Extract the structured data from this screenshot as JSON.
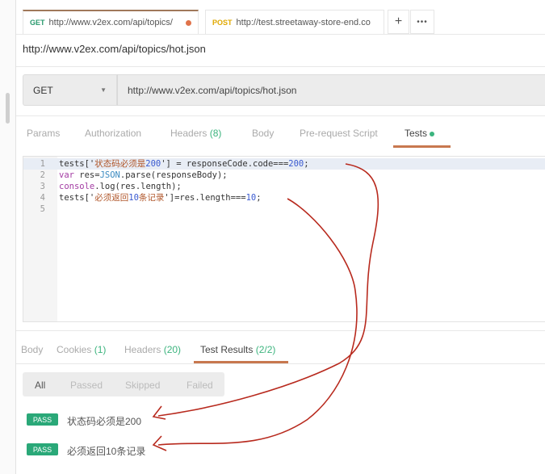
{
  "tabs": [
    {
      "method": "GET",
      "url": "http://www.v2ex.com/api/topics/",
      "unsaved": true
    },
    {
      "method": "POST",
      "url": "http://test.streetaway-store-end.co"
    }
  ],
  "tab_actions": {
    "add": "+",
    "more": "•••"
  },
  "request": {
    "title": "http://www.v2ex.com/api/topics/hot.json",
    "method": "GET",
    "url": "http://www.v2ex.com/api/topics/hot.json"
  },
  "request_tabs": [
    {
      "label": "Params"
    },
    {
      "label": "Authorization"
    },
    {
      "label": "Headers",
      "count": "(8)"
    },
    {
      "label": "Body"
    },
    {
      "label": "Pre-request Script"
    },
    {
      "label": "Tests",
      "active": true
    }
  ],
  "editor": {
    "line_numbers": [
      "1",
      "2",
      "3",
      "4",
      "5"
    ],
    "lines": [
      [
        "tests['",
        "状态码必须是",
        "200",
        "'] = responseCode.code===",
        "200",
        ";"
      ],
      [
        "var",
        " res=",
        "JSON",
        ".parse(responseBody);"
      ],
      [
        "console",
        ".log(res.length);"
      ],
      [
        "tests['",
        "必须返回",
        "10",
        "条记录",
        "']=res.length===",
        "10",
        ";"
      ],
      []
    ]
  },
  "response_tabs": [
    {
      "label": "Body"
    },
    {
      "label": "Cookies",
      "count": "(1)"
    },
    {
      "label": "Headers",
      "count": "(20)"
    },
    {
      "label": "Test Results",
      "count": "(2/2)",
      "active": true
    }
  ],
  "filters": [
    "All",
    "Passed",
    "Skipped",
    "Failed"
  ],
  "results": [
    {
      "status": "PASS",
      "name": "状态码必须是200"
    },
    {
      "status": "PASS",
      "name": "必须返回10条记录"
    }
  ],
  "colors": {
    "accent": "#e0734a",
    "pass": "#2aa878",
    "annotation": "#c0281c"
  }
}
